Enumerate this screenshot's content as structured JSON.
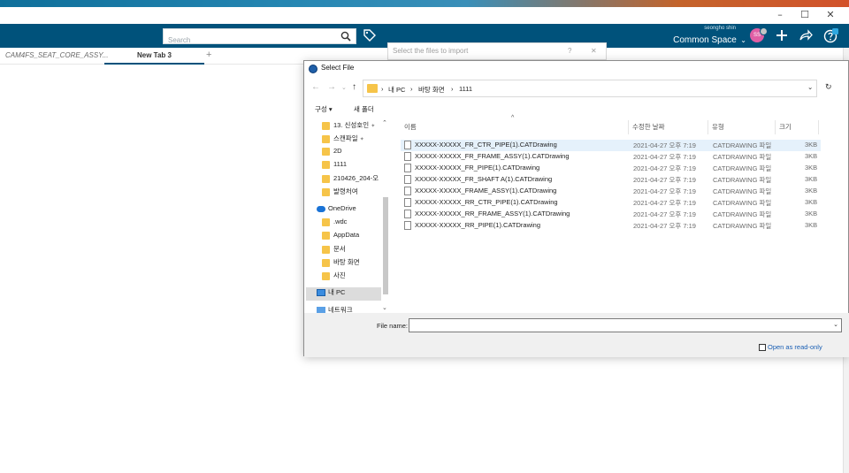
{
  "app": {
    "user_name": "seongho shin",
    "space_name": "Common Space",
    "avatar_initials": "SS",
    "search_placeholder": "Search",
    "accent": "#00527b"
  },
  "window_controls": {
    "minimize": "–",
    "maximize": "☐",
    "close": "✕"
  },
  "tabs": [
    {
      "label": "CAM4FS_SEAT_CORE_ASSY..."
    },
    {
      "label": "New Tab 3"
    },
    {
      "label": "+"
    }
  ],
  "behind_dialog": {
    "title": "Select the files to import",
    "help": "?",
    "close": "✕"
  },
  "file_dialog": {
    "title": "Select File",
    "nav": {
      "back": "←",
      "forward": "→",
      "dropdown": "⌄",
      "up": "↑",
      "address_dropdown": "⌄",
      "refresh": "↻"
    },
    "breadcrumb": [
      "›",
      "내 PC",
      "›",
      "바탕 화면",
      "›",
      "1111"
    ],
    "commands": {
      "organize": "구성 ▾",
      "new_folder": "새 폴더"
    },
    "nav_items": [
      {
        "label": "13. 신성호인",
        "type": "folder",
        "pinned": true
      },
      {
        "label": "스캔파일",
        "type": "folder",
        "pinned": true
      },
      {
        "label": "2D",
        "type": "folder"
      },
      {
        "label": "1111",
        "type": "folder"
      },
      {
        "label": "210426_204-오",
        "type": "folder"
      },
      {
        "label": "발령처여",
        "type": "folder"
      },
      {
        "label": "OneDrive",
        "type": "onedrive"
      },
      {
        "label": ".wdc",
        "type": "folder"
      },
      {
        "label": "AppData",
        "type": "folder"
      },
      {
        "label": "문서",
        "type": "folder"
      },
      {
        "label": "바탕 화면",
        "type": "folder"
      },
      {
        "label": "사진",
        "type": "folder"
      },
      {
        "label": "내 PC",
        "type": "pc",
        "selected": true
      },
      {
        "label": "네트워크",
        "type": "network"
      }
    ],
    "columns": {
      "name": "이름",
      "date": "수정한 날짜",
      "type": "유형",
      "size": "크기",
      "sort": "^"
    },
    "files": [
      {
        "name": "XXXXX-XXXXX_FR_CTR_PIPE(1).CATDrawing",
        "date": "2021-04-27 오후 7:19",
        "type": "CATDRAWING 파일",
        "size": "3KB",
        "selected": true
      },
      {
        "name": "XXXXX-XXXXX_FR_FRAME_ASSY(1).CATDrawing",
        "date": "2021-04-27 오후 7:19",
        "type": "CATDRAWING 파일",
        "size": "3KB"
      },
      {
        "name": "XXXXX-XXXXX_FR_PIPE(1).CATDrawing",
        "date": "2021-04-27 오후 7:19",
        "type": "CATDRAWING 파일",
        "size": "3KB"
      },
      {
        "name": "XXXXX-XXXXX_FR_SHAFT A(1).CATDrawing",
        "date": "2021-04-27 오후 7:19",
        "type": "CATDRAWING 파일",
        "size": "3KB"
      },
      {
        "name": "XXXXX-XXXXX_FRAME_ASSY(1).CATDrawing",
        "date": "2021-04-27 오후 7:19",
        "type": "CATDRAWING 파일",
        "size": "3KB"
      },
      {
        "name": "XXXXX-XXXXX_RR_CTR_PIPE(1).CATDrawing",
        "date": "2021-04-27 오후 7:19",
        "type": "CATDRAWING 파일",
        "size": "3KB"
      },
      {
        "name": "XXXXX-XXXXX_RR_FRAME_ASSY(1).CATDrawing",
        "date": "2021-04-27 오후 7:19",
        "type": "CATDRAWING 파일",
        "size": "3KB"
      },
      {
        "name": "XXXXX-XXXXX_RR_PIPE(1).CATDrawing",
        "date": "2021-04-27 오후 7:19",
        "type": "CATDRAWING 파일",
        "size": "3KB"
      }
    ],
    "file_name_label": "File name:",
    "file_name_value": "",
    "file_name_dropdown": "⌄",
    "read_only_label": "Open as read-only",
    "scroll_up": "⌃",
    "scroll_down": "⌄"
  }
}
